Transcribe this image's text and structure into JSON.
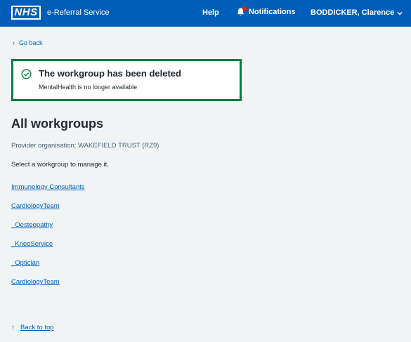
{
  "header": {
    "logo": "NHS",
    "service_name": "e-Referral Service",
    "help_label": "Help",
    "notifications_label": "Notifications",
    "user_name": "BODDICKER, Clarence",
    "brand_color": "#005eb8",
    "notification_dot_color": "#d5281b"
  },
  "nav": {
    "back_label": "Go back"
  },
  "success": {
    "title": "The workgroup has been deleted",
    "message": "MentalHealth is no longer available",
    "border_color": "#007f3b"
  },
  "main": {
    "title": "All workgroups",
    "provider": "Provider organisation: WAKEFIELD TRUST (RZ9)",
    "instruction": "Select a workgroup to manage it.",
    "workgroups": [
      " Immunology Consultants",
      " CardiologyTeam",
      " _Oesteopathy",
      " _KneeService",
      " _Optician",
      " CardiologyTeam"
    ]
  },
  "footer": {
    "back_to_top": "Back to top"
  }
}
